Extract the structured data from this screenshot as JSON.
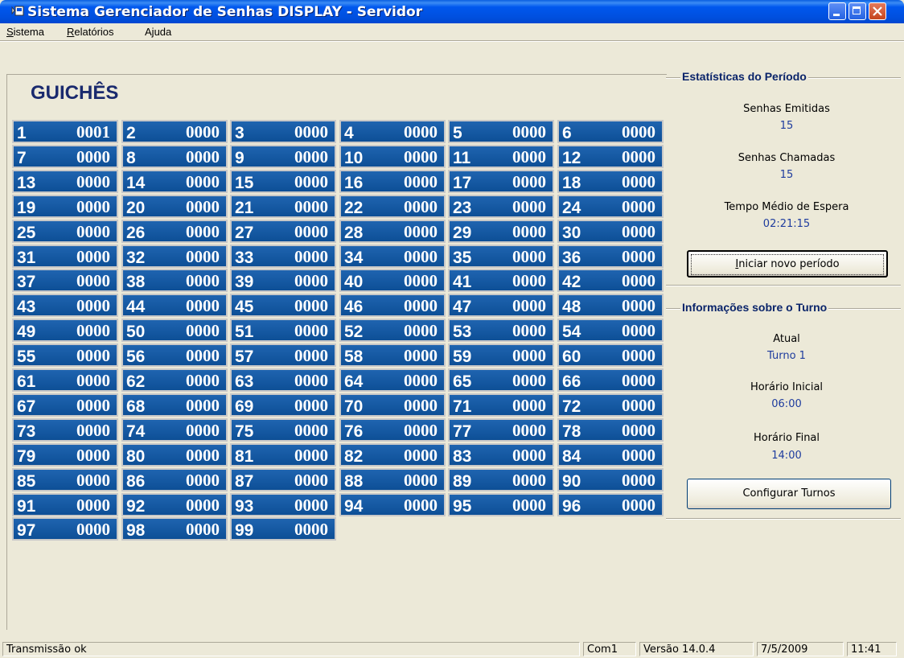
{
  "window": {
    "title": "Sistema Gerenciador de Senhas DISPLAY - Servidor"
  },
  "menu": {
    "sistema": {
      "ul": "S",
      "rest": "istema"
    },
    "relatorios": {
      "ul": "R",
      "rest": "elatórios"
    },
    "ajuda": {
      "pre": "A",
      "ul": "j",
      "rest": "uda"
    }
  },
  "heading": "GUICHÊS",
  "counters": [
    {
      "n": "1",
      "v": "0001"
    },
    {
      "n": "2",
      "v": "0000"
    },
    {
      "n": "3",
      "v": "0000"
    },
    {
      "n": "4",
      "v": "0000"
    },
    {
      "n": "5",
      "v": "0000"
    },
    {
      "n": "6",
      "v": "0000"
    },
    {
      "n": "7",
      "v": "0000"
    },
    {
      "n": "8",
      "v": "0000"
    },
    {
      "n": "9",
      "v": "0000"
    },
    {
      "n": "10",
      "v": "0000"
    },
    {
      "n": "11",
      "v": "0000"
    },
    {
      "n": "12",
      "v": "0000"
    },
    {
      "n": "13",
      "v": "0000"
    },
    {
      "n": "14",
      "v": "0000"
    },
    {
      "n": "15",
      "v": "0000"
    },
    {
      "n": "16",
      "v": "0000"
    },
    {
      "n": "17",
      "v": "0000"
    },
    {
      "n": "18",
      "v": "0000"
    },
    {
      "n": "19",
      "v": "0000"
    },
    {
      "n": "20",
      "v": "0000"
    },
    {
      "n": "21",
      "v": "0000"
    },
    {
      "n": "22",
      "v": "0000"
    },
    {
      "n": "23",
      "v": "0000"
    },
    {
      "n": "24",
      "v": "0000"
    },
    {
      "n": "25",
      "v": "0000"
    },
    {
      "n": "26",
      "v": "0000"
    },
    {
      "n": "27",
      "v": "0000"
    },
    {
      "n": "28",
      "v": "0000"
    },
    {
      "n": "29",
      "v": "0000"
    },
    {
      "n": "30",
      "v": "0000"
    },
    {
      "n": "31",
      "v": "0000"
    },
    {
      "n": "32",
      "v": "0000"
    },
    {
      "n": "33",
      "v": "0000"
    },
    {
      "n": "34",
      "v": "0000"
    },
    {
      "n": "35",
      "v": "0000"
    },
    {
      "n": "36",
      "v": "0000"
    },
    {
      "n": "37",
      "v": "0000"
    },
    {
      "n": "38",
      "v": "0000"
    },
    {
      "n": "39",
      "v": "0000"
    },
    {
      "n": "40",
      "v": "0000"
    },
    {
      "n": "41",
      "v": "0000"
    },
    {
      "n": "42",
      "v": "0000"
    },
    {
      "n": "43",
      "v": "0000"
    },
    {
      "n": "44",
      "v": "0000"
    },
    {
      "n": "45",
      "v": "0000"
    },
    {
      "n": "46",
      "v": "0000"
    },
    {
      "n": "47",
      "v": "0000"
    },
    {
      "n": "48",
      "v": "0000"
    },
    {
      "n": "49",
      "v": "0000"
    },
    {
      "n": "50",
      "v": "0000"
    },
    {
      "n": "51",
      "v": "0000"
    },
    {
      "n": "52",
      "v": "0000"
    },
    {
      "n": "53",
      "v": "0000"
    },
    {
      "n": "54",
      "v": "0000"
    },
    {
      "n": "55",
      "v": "0000"
    },
    {
      "n": "56",
      "v": "0000"
    },
    {
      "n": "57",
      "v": "0000"
    },
    {
      "n": "58",
      "v": "0000"
    },
    {
      "n": "59",
      "v": "0000"
    },
    {
      "n": "60",
      "v": "0000"
    },
    {
      "n": "61",
      "v": "0000"
    },
    {
      "n": "62",
      "v": "0000"
    },
    {
      "n": "63",
      "v": "0000"
    },
    {
      "n": "64",
      "v": "0000"
    },
    {
      "n": "65",
      "v": "0000"
    },
    {
      "n": "66",
      "v": "0000"
    },
    {
      "n": "67",
      "v": "0000"
    },
    {
      "n": "68",
      "v": "0000"
    },
    {
      "n": "69",
      "v": "0000"
    },
    {
      "n": "70",
      "v": "0000"
    },
    {
      "n": "71",
      "v": "0000"
    },
    {
      "n": "72",
      "v": "0000"
    },
    {
      "n": "73",
      "v": "0000"
    },
    {
      "n": "74",
      "v": "0000"
    },
    {
      "n": "75",
      "v": "0000"
    },
    {
      "n": "76",
      "v": "0000"
    },
    {
      "n": "77",
      "v": "0000"
    },
    {
      "n": "78",
      "v": "0000"
    },
    {
      "n": "79",
      "v": "0000"
    },
    {
      "n": "80",
      "v": "0000"
    },
    {
      "n": "81",
      "v": "0000"
    },
    {
      "n": "82",
      "v": "0000"
    },
    {
      "n": "83",
      "v": "0000"
    },
    {
      "n": "84",
      "v": "0000"
    },
    {
      "n": "85",
      "v": "0000"
    },
    {
      "n": "86",
      "v": "0000"
    },
    {
      "n": "87",
      "v": "0000"
    },
    {
      "n": "88",
      "v": "0000"
    },
    {
      "n": "89",
      "v": "0000"
    },
    {
      "n": "90",
      "v": "0000"
    },
    {
      "n": "91",
      "v": "0000"
    },
    {
      "n": "92",
      "v": "0000"
    },
    {
      "n": "93",
      "v": "0000"
    },
    {
      "n": "94",
      "v": "0000"
    },
    {
      "n": "95",
      "v": "0000"
    },
    {
      "n": "96",
      "v": "0000"
    },
    {
      "n": "97",
      "v": "0000"
    },
    {
      "n": "98",
      "v": "0000"
    },
    {
      "n": "99",
      "v": "0000"
    }
  ],
  "stats": {
    "title": "Estatísticas do Período",
    "issued_label": "Senhas Emitidas",
    "issued_value": "15",
    "called_label": "Senhas Chamadas",
    "called_value": "15",
    "avg_wait_label": "Tempo Médio de Espera",
    "avg_wait_value": "02:21:15",
    "new_period_button": {
      "ul": "I",
      "rest": "niciar novo período"
    }
  },
  "shift": {
    "title": "Informações sobre o Turno",
    "current_label": "Atual",
    "current_value": "Turno 1",
    "start_label": "Horário Inicial",
    "start_value": "06:00",
    "end_label": "Horário Final",
    "end_value": "14:00",
    "configure_button": "Configurar Turnos"
  },
  "statusbar": {
    "message": "Transmissão ok",
    "port": "Com1",
    "version": "Versão 14.0.4",
    "date": "7/5/2009",
    "time": "11:41"
  },
  "colors": {
    "cell_bg": "#1f64b0",
    "heading": "#1a2a6e",
    "value_text": "#1e3c9e",
    "window_bg": "#ece9d8"
  }
}
